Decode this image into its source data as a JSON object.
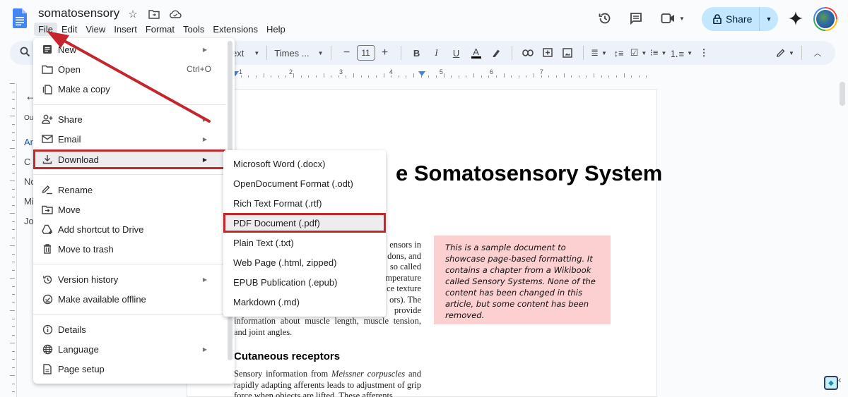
{
  "app": {
    "doc_title": "somatosensory",
    "title_icons": [
      "star-icon",
      "move-to-folder-icon",
      "cloud-saved-icon"
    ]
  },
  "menubar": [
    "File",
    "Edit",
    "View",
    "Insert",
    "Format",
    "Tools",
    "Extensions",
    "Help"
  ],
  "header_actions": {
    "share_label": "Share",
    "icons": [
      "version-history-icon",
      "comments-icon",
      "meet-icon",
      "gemini-icon",
      "avatar"
    ]
  },
  "toolbar": {
    "style_label": "ext",
    "font_label": "Times ...",
    "font_size": "11",
    "decrease": "−",
    "increase": "+",
    "bold": "B",
    "italic": "I",
    "underline": "U",
    "text_color": "A"
  },
  "ruler": {
    "numbers": [
      "1",
      "2",
      "3",
      "4",
      "5",
      "6",
      "7"
    ]
  },
  "outline": {
    "items": [
      "Ou",
      "Ar",
      "C",
      "No",
      "Mi",
      "Jo"
    ]
  },
  "file_menu": {
    "items": [
      {
        "label": "New",
        "icon": "new-doc-icon",
        "submenu": true
      },
      {
        "label": "Open",
        "icon": "folder-icon",
        "shortcut": "Ctrl+O"
      },
      {
        "label": "Make a copy",
        "icon": "copy-icon"
      },
      {
        "label": "Share",
        "icon": "person-add-icon",
        "submenu": true
      },
      {
        "label": "Email",
        "icon": "mail-icon",
        "submenu": true
      },
      {
        "label": "Download",
        "icon": "download-icon",
        "submenu": true,
        "highlighted": true
      },
      {
        "label": "Rename",
        "icon": "rename-icon"
      },
      {
        "label": "Move",
        "icon": "move-folder-icon"
      },
      {
        "label": "Add shortcut to Drive",
        "icon": "drive-shortcut-icon"
      },
      {
        "label": "Move to trash",
        "icon": "trash-icon"
      },
      {
        "label": "Version history",
        "icon": "history-icon",
        "submenu": true
      },
      {
        "label": "Make available offline",
        "icon": "offline-icon"
      },
      {
        "label": "Details",
        "icon": "info-icon"
      },
      {
        "label": "Language",
        "icon": "globe-icon",
        "submenu": true
      },
      {
        "label": "Page setup",
        "icon": "page-setup-icon"
      }
    ]
  },
  "download_menu": {
    "items": [
      "Microsoft Word (.docx)",
      "OpenDocument Format (.odt)",
      "Rich Text Format (.rtf)",
      "PDF Document (.pdf)",
      "Plain Text (.txt)",
      "Web Page (.html, zipped)",
      "EPUB Publication (.epub)",
      "Markdown (.md)"
    ],
    "highlighted": "PDF Document (.pdf)"
  },
  "document": {
    "title_visible": "e Somatosensory System",
    "right_fragments": [
      "ensors in",
      "dons, and",
      "so called",
      "mperature",
      "ce texture",
      "ors). The",
      "provide"
    ],
    "paragraph_tail": "information about muscle length, muscle tension, and joint angles.",
    "section_heading": "Cutaneous receptors",
    "section_text_1": "Sensory information from ",
    "section_text_italic": "Meissner corpuscles",
    "section_text_2": " and rapidly adapting afferents leads to adjustment of grip force when objects are lifted. These afferents",
    "callout": "This is a sample document to showcase page-based formatting. It contains a chapter from a Wikibook called Sensory Systems. None of the content has been changed in this article, but some content has been removed."
  },
  "colors": {
    "highlight_border": "#c4262e",
    "share_bg": "#c2e7ff",
    "callout_bg": "#fccfd1",
    "toolbar_bg": "#edf2fa",
    "doc_blue": "#4285f4"
  }
}
